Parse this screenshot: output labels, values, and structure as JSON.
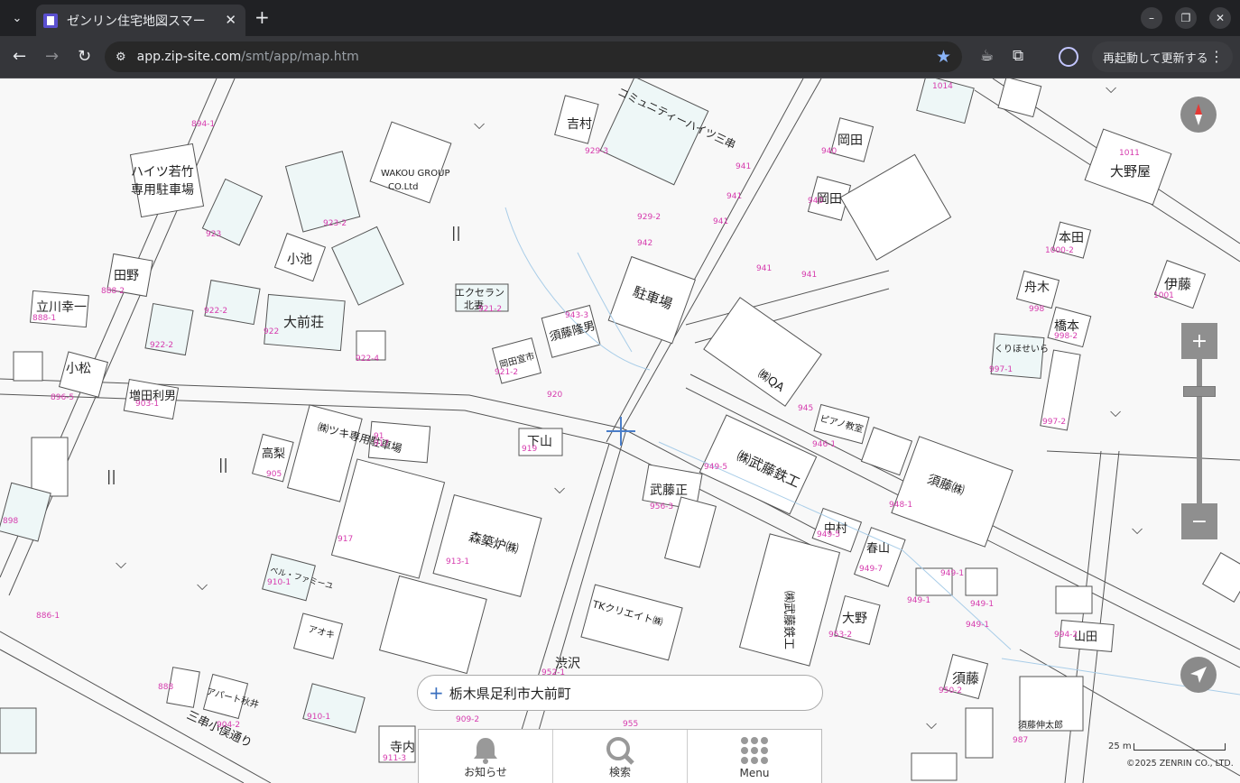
{
  "browser": {
    "tab_title": "ゼンリン住宅地図スマー",
    "url_host": "app.zip-site.com",
    "url_path": "/smt/app/map.htm",
    "update_button": "再起動して更新する"
  },
  "map": {
    "search_address": "栃木県足利市大前町",
    "scale_label": "25 m",
    "copyright": "©2025 ZENRIN CO., LTD.",
    "labels": {
      "haitsu_wakatake": "ハイツ若竹",
      "senyo_chushajo": "専用駐車場",
      "wakou_group": "WAKOU GROUP",
      "co_ltd": "CO.Ltd",
      "yoshimura": "吉村",
      "community_heights": "コミュニティーハイツ三串",
      "okada1": "岡田",
      "okada2": "岡田",
      "oono_ya": "大野屋",
      "tano": "田野",
      "koike": "小池",
      "tachikawa": "立川幸一",
      "ohmae_so": "大前荘",
      "excellan": "エクセラン",
      "kitazuma": "北妻",
      "chushajo": "駐車場",
      "sudo_takao": "須藤隆男",
      "okada_kouichi": "岡田宣市",
      "honda": "本田",
      "funaki": "舟木",
      "hashimoto": "橋本",
      "ito": "伊藤",
      "komatsu": "小松",
      "masuda": "増田利男",
      "kurihoseira": "くりほせいら",
      "tsuki_senyo": "㈱ツキ専用駐車場",
      "shimoyama": "下山",
      "takanashi": "高梨",
      "muto_tekko": "㈱武藤鉄工",
      "piano": "ピアノ教室",
      "sudo_kk": "須藤㈱",
      "muto_tadashi": "武藤正",
      "nakamura": "中村",
      "haruyama": "春山",
      "morihara": "森築炉㈱",
      "tk_create": "TKクリエイト㈱",
      "ohno": "大野",
      "yamada": "山田",
      "sudo": "須藤",
      "shibusawa": "渋沢",
      "teranouchi": "寺内",
      "apart": "アパート秋井",
      "sanchoume": "三串小俣通り",
      "aoki": "アオキ",
      "bell_family": "ベル・ファミーユ",
      "koonta": "㈱QA",
      "sudo_nobutaro": "須藤伸太郎"
    }
  },
  "nav": {
    "notice": "お知らせ",
    "search": "検索",
    "menu": "Menu"
  }
}
